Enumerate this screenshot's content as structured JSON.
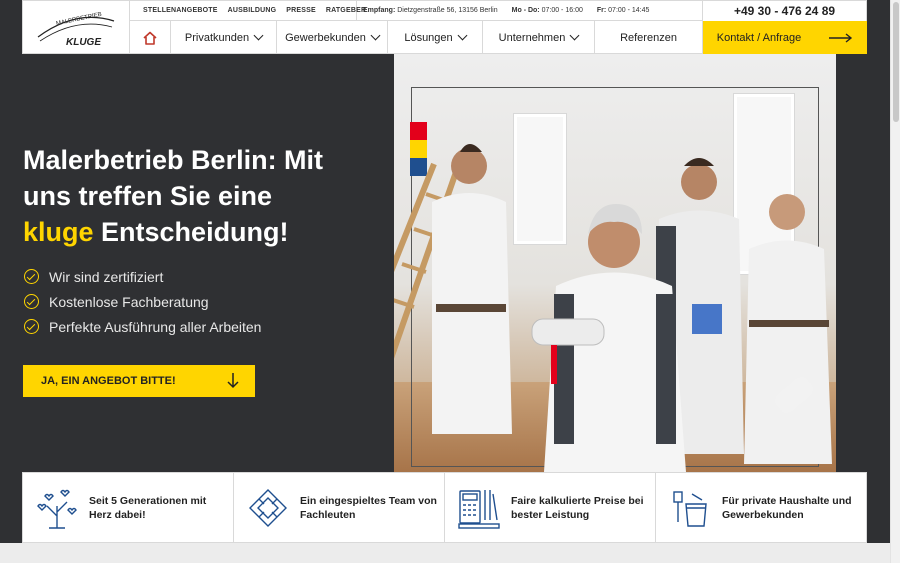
{
  "header": {
    "logo_text_top": "MALERBETRIEB",
    "logo_text_bottom": "KLUGE",
    "top_links": [
      "STELLENANGEBOTE",
      "AUSBILDUNG",
      "PRESSE",
      "RATGEBER"
    ],
    "address_label": "Empfang:",
    "address": "Dietzgenstraße 56, 13156 Berlin",
    "hours_1_label": "Mo - Do:",
    "hours_1": "07:00 - 16:00",
    "hours_2_label": "Fr:",
    "hours_2": "07:00 - 14:45",
    "phone": "+49 30 - 476 24 89"
  },
  "nav": {
    "items": [
      {
        "label": "Privatkunden",
        "dropdown": true
      },
      {
        "label": "Gewerbekunden",
        "dropdown": true
      },
      {
        "label": "Lösungen",
        "dropdown": true
      },
      {
        "label": "Unternehmen",
        "dropdown": true
      },
      {
        "label": "Referenzen",
        "dropdown": false
      }
    ],
    "cta_label": "Kontakt / Anfrage"
  },
  "hero": {
    "title_line1": "Malerbetrieb Berlin: Mit",
    "title_line2": "uns treffen Sie eine",
    "title_highlight": "kluge",
    "title_line3_rest": " Entscheidung!",
    "checks": [
      "Wir sind zertifiziert",
      "Kostenlose Fachberatung",
      "Perfekte Ausführung aller Arbeiten"
    ],
    "cta_label": "JA, EIN ANGEBOT BITTE!"
  },
  "features": [
    {
      "icon": "tree-hearts-icon",
      "text_1": "Seit 5 Generationen mit",
      "text_2": "Herz dabei!"
    },
    {
      "icon": "team-hands-icon",
      "text_1": "Ein eingespieltes Team von",
      "text_2": "Fachleuten"
    },
    {
      "icon": "calculator-tools-icon",
      "text_1": "Faire kalkulierte Preise bei",
      "text_2": "bester Leistung"
    },
    {
      "icon": "paint-bucket-icon",
      "text_1": "Für private Haushalte und",
      "text_2": "Gewerbekunden"
    }
  ],
  "colors": {
    "accent": "#ffd500",
    "background": "#2f3033",
    "icon_blue": "#1f4f8f"
  }
}
